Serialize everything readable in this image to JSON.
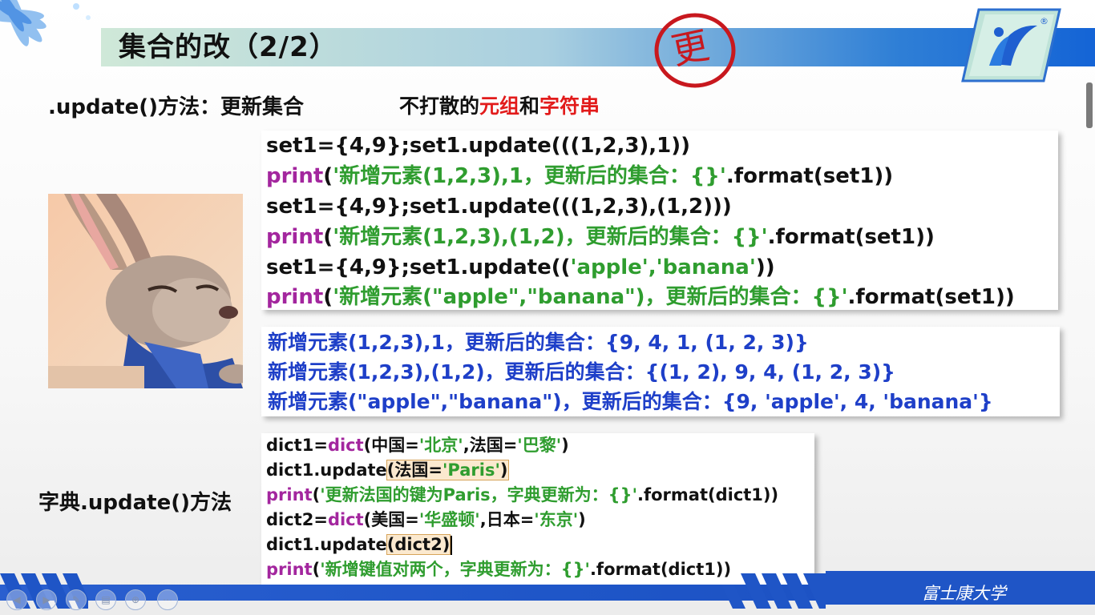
{
  "slide": {
    "title": "集合的改（2/2）",
    "stamp_char": "更",
    "update_heading": ".update()方法：更新集合",
    "note": {
      "prefix": "不打散的",
      "highlight_1": "元组",
      "middle": "和",
      "highlight_2": "字符串"
    },
    "dict_heading": "字典.update()方法",
    "university": "富士康大学"
  },
  "code_block_1": [
    {
      "plain": "set1={4,9};set1.update(((1,2,3),1))"
    },
    {
      "fn": "print",
      "open": "(",
      "str": "'新增元素(1,2,3),1，更新后的集合：{}'",
      "rest": ".format(set1))"
    },
    {
      "plain": "set1={4,9};set1.update(((1,2,3),(1,2)))"
    },
    {
      "fn": "print",
      "open": "(",
      "str": "'新增元素(1,2,3),(1,2)，更新后的集合：{}'",
      "rest": ".format(set1))"
    },
    {
      "pre": "set1={4,9};set1.update((",
      "str": "'apple','banana'",
      "rest": "))"
    },
    {
      "fn": "print",
      "open": "(",
      "str": "'新增元素(\"apple\",\"banana\")，更新后的集合：{}'",
      "rest": ".format(set1))"
    }
  ],
  "output_block": [
    "新增元素(1,2,3),1，更新后的集合：{9, 4, 1, (1, 2, 3)}",
    "新增元素(1,2,3),(1,2)，更新后的集合：{(1, 2), 9, 4, (1, 2, 3)}",
    "新增元素(\"apple\",\"banana\")，更新后的集合：{9, 'apple', 4, 'banana'}"
  ],
  "code_block_2": {
    "line1": {
      "pre": "dict1=",
      "fn": "dict",
      "a": "(中国=",
      "s1": "'北京'",
      "b": ",法国=",
      "s2": "'巴黎'",
      "c": ")"
    },
    "line2": {
      "pre": "dict1.update",
      "h_open": "(法国=",
      "h_str": "'Paris'",
      "h_close": ")"
    },
    "line3": {
      "fn": "print",
      "open": "(",
      "str": "'更新法国的键为Paris，字典更新为：{}'",
      "rest": ".format(dict1))"
    },
    "line4": {
      "pre": "dict2=",
      "fn": "dict",
      "a": "(美国=",
      "s1": "'华盛顿'",
      "b": ",日本=",
      "s2": "'东京'",
      "c": ")"
    },
    "line5": {
      "pre": "dict1.update",
      "h": "(dict2)"
    },
    "line6": {
      "fn": "print",
      "open": "(",
      "str": "'新增键值对两个，字典更新为：{}'",
      "rest": ".format(dict1))"
    }
  },
  "nav_controls": [
    {
      "icon": "back-icon",
      "glyph": "◀"
    },
    {
      "icon": "forward-icon",
      "glyph": "▶"
    },
    {
      "icon": "pen-icon",
      "glyph": "✎"
    },
    {
      "icon": "slides-icon",
      "glyph": "▤"
    },
    {
      "icon": "zoom-icon",
      "glyph": "⊕"
    },
    {
      "icon": "more-icon",
      "glyph": "⋯"
    }
  ],
  "colors": {
    "string": "#2f9d2f",
    "function": "#a3269e",
    "output": "#1e3fc8",
    "accent_red": "#e21b1b",
    "brand_blue": "#1f55c6"
  }
}
